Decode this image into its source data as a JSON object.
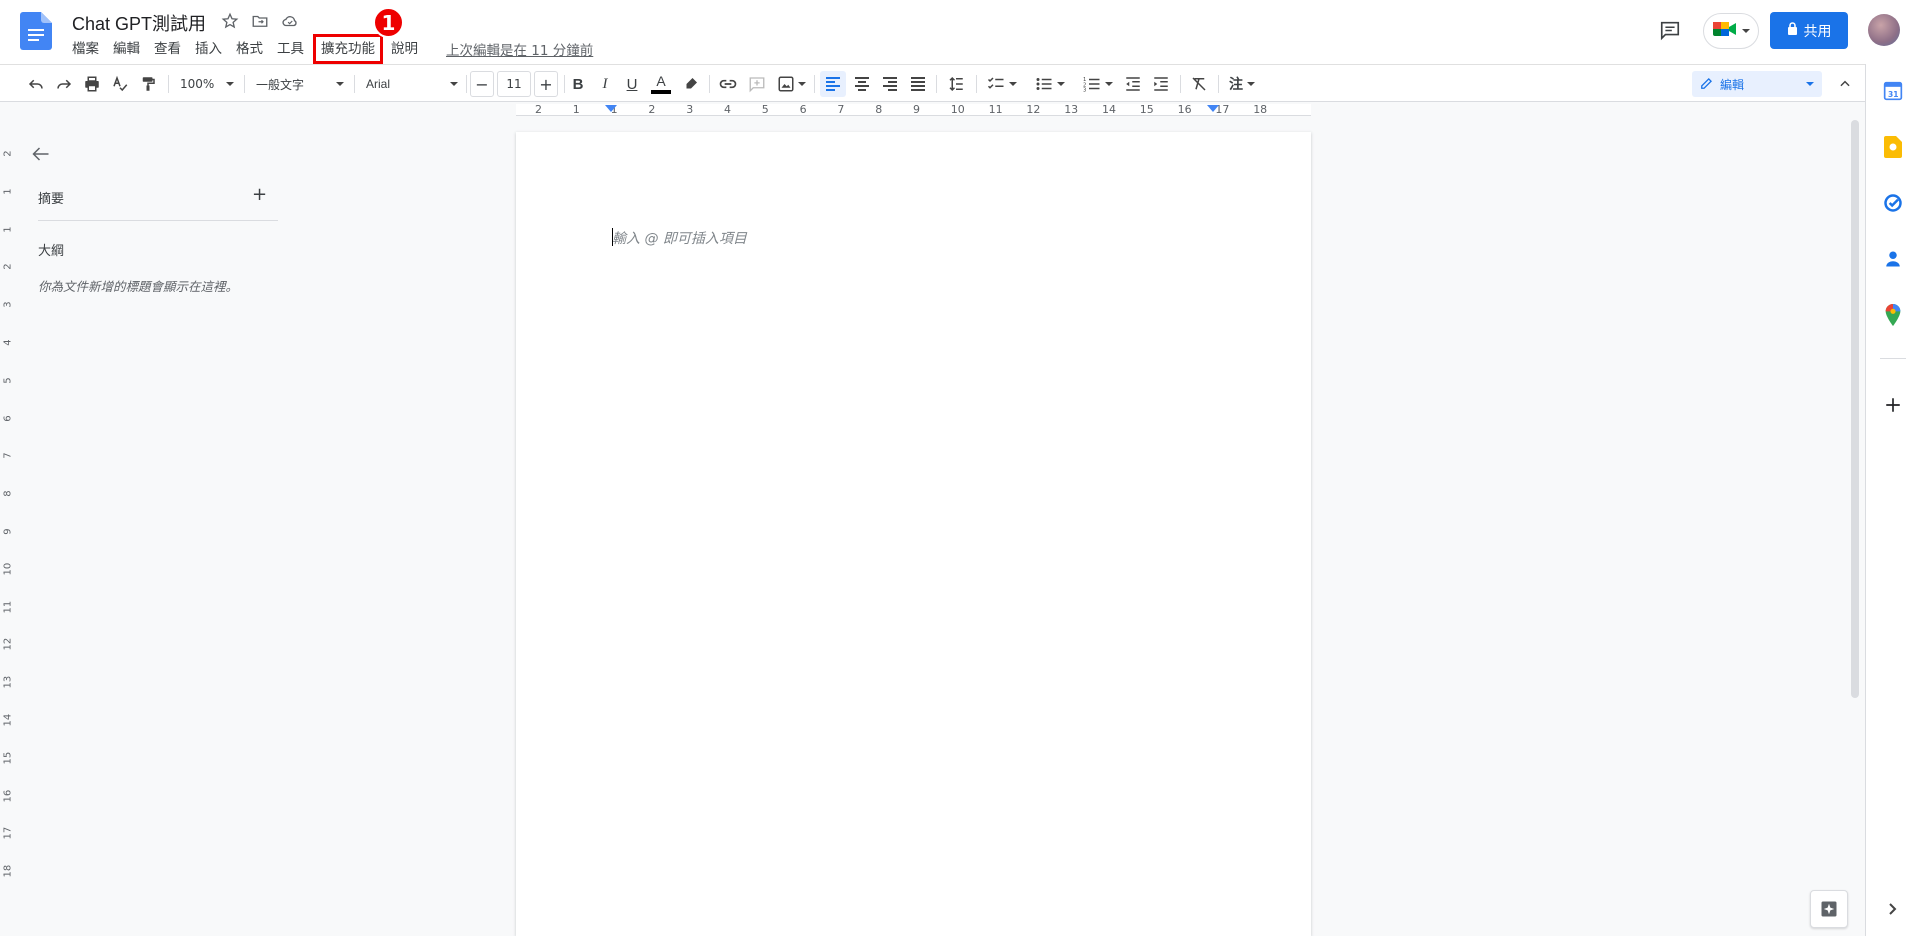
{
  "doc": {
    "title": "Chat GPT測試用"
  },
  "menu": {
    "items": [
      "檔案",
      "編輯",
      "查看",
      "插入",
      "格式",
      "工具"
    ],
    "extensions": "擴充功能",
    "help": "說明",
    "last_edit": "上次編輯是在 11 分鐘前"
  },
  "annotation": {
    "badge": "1",
    "highlight_color": "#e00000"
  },
  "header": {
    "share_label": "共用"
  },
  "toolbar": {
    "zoom": "100%",
    "style": "一般文字",
    "font": "Arial",
    "font_size": "11",
    "mode": "編輯",
    "icons": [
      "undo-icon",
      "redo-icon",
      "print-icon",
      "spellcheck-icon",
      "paint-format-icon",
      "bold-icon",
      "italic-icon",
      "underline-icon",
      "text-color-icon",
      "highlight-icon",
      "link-icon",
      "comment-add-icon",
      "image-icon",
      "align-left-icon",
      "align-center-icon",
      "align-right-icon",
      "justify-icon",
      "line-spacing-icon",
      "checklist-icon",
      "bullet-list-icon",
      "numbered-list-icon",
      "indent-decrease-icon",
      "indent-increase-icon",
      "clear-format-icon",
      "input-tools-icon",
      "collapse-icon"
    ]
  },
  "ruler": {
    "h_ticks": [
      "2",
      "1",
      "1",
      "2",
      "3",
      "4",
      "5",
      "6",
      "7",
      "8",
      "9",
      "10",
      "11",
      "12",
      "13",
      "14",
      "15",
      "16",
      "17",
      "18"
    ],
    "v_ticks": [
      "2",
      "1",
      "1",
      "2",
      "3",
      "4",
      "5",
      "6",
      "7",
      "8",
      "9",
      "10",
      "11",
      "12",
      "13",
      "14",
      "15",
      "16",
      "17",
      "18"
    ]
  },
  "sidepanel": {
    "summary": "摘要",
    "outline": "大綱",
    "outline_hint": "你為文件新增的標題會顯示在這裡。"
  },
  "page": {
    "placeholder": "輸入 @ 即可插入項目"
  },
  "colors": {
    "accent": "#1a73e8",
    "annotation": "#e00000"
  },
  "side_rail": [
    "calendar-icon",
    "keep-icon",
    "tasks-icon",
    "contacts-icon",
    "maps-icon",
    "add-icon",
    "expand-icon"
  ]
}
